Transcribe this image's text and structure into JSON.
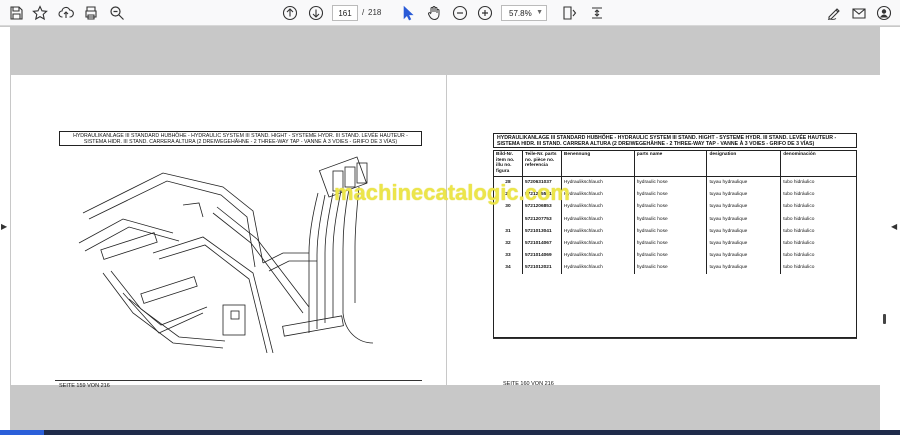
{
  "toolbar": {
    "page_current": "161",
    "page_separator": "/",
    "page_total": "218",
    "zoom": "57.8%"
  },
  "left_page": {
    "header": "HYDRAULIKANLAGE III STANDARD HUBHÖHE - HYDRAULIC SYSTEM III STAND. HIGHT - SYSTEME HYDR. III STAND. LEVÉE HAUTEUR - SISTEMA HIDR. III STAND. CARRERA ALTURA (2 DREIWEGEHÄHNE - 2 THREE-WAY TAP - VANNE À 3 VOIES - GRIFO DE 3 VÍAS)",
    "footer": "SEITE 159 VON 216"
  },
  "right_page": {
    "header": "HYDRAULIKANLAGE III STANDARD HUBHÖHE - HYDRAULIC SYSTEM III STAND. HIGHT - SYSTEME HYDR. III STAND. LEVÉE HAUTEUR - SISTEMA HIDR. III STAND. CARRERA ALTURA (2 DREIWEGEHÄHNE - 2 THREE-WAY TAP - VANNE À 3 VOIES - GRIFO DE 3 VÍAS)",
    "columns": [
      "Bild-Nr. item no. illu no. figura",
      "Teile-Nr. parts no. pièce no. referencia",
      "Benennung",
      "parts name",
      "designation",
      "denominación"
    ],
    "rows": [
      {
        "item": "28",
        "part": "5720631037",
        "de": "Hydraulikschlauch",
        "en": "hydraulic hose",
        "fr": "tuyau hydraulique",
        "es": "tubo hidráulico"
      },
      {
        "item": "29",
        "part": "5721225521",
        "de": "Hydraulikschlauch",
        "en": "hydraulic hose",
        "fr": "tuyau hydraulique",
        "es": "tubo hidráulico"
      },
      {
        "item": "30",
        "part": "5721206853",
        "de": "Hydraulikschlauch",
        "en": "hydraulic hose",
        "fr": "tuyau hydraulique",
        "es": "tubo hidráulico"
      },
      {
        "item": "",
        "part": "5721207753",
        "de": "Hydraulikschlauch",
        "en": "hydraulic hose",
        "fr": "tuyau hydraulique",
        "es": "tubo hidráulico"
      },
      {
        "item": "31",
        "part": "5721013041",
        "de": "Hydraulikschlauch",
        "en": "hydraulic hose",
        "fr": "tuyau hydraulique",
        "es": "tubo hidráulico"
      },
      {
        "item": "32",
        "part": "5721014067",
        "de": "Hydraulikschlauch",
        "en": "hydraulic hose",
        "fr": "tuyau hydraulique",
        "es": "tubo hidráulico"
      },
      {
        "item": "33",
        "part": "5721014069",
        "de": "Hydraulikschlauch",
        "en": "hydraulic hose",
        "fr": "tuyau hydraulique",
        "es": "tubo hidráulico"
      },
      {
        "item": "34",
        "part": "5721012021",
        "de": "Hydraulikschlauch",
        "en": "hydraulic hose",
        "fr": "tuyau hydraulique",
        "es": "tubo hidráulico"
      }
    ],
    "footer": "SEITE 160 VON 216"
  },
  "watermark": "machinecatalogic.com",
  "colors": {
    "toolbar_bg": "#f9f9fa",
    "viewer_bg": "#c8c8c8",
    "watermark": "#ece54a",
    "taskbar": "#1f2b4a",
    "taskbar_accent": "#2b5fd9"
  }
}
